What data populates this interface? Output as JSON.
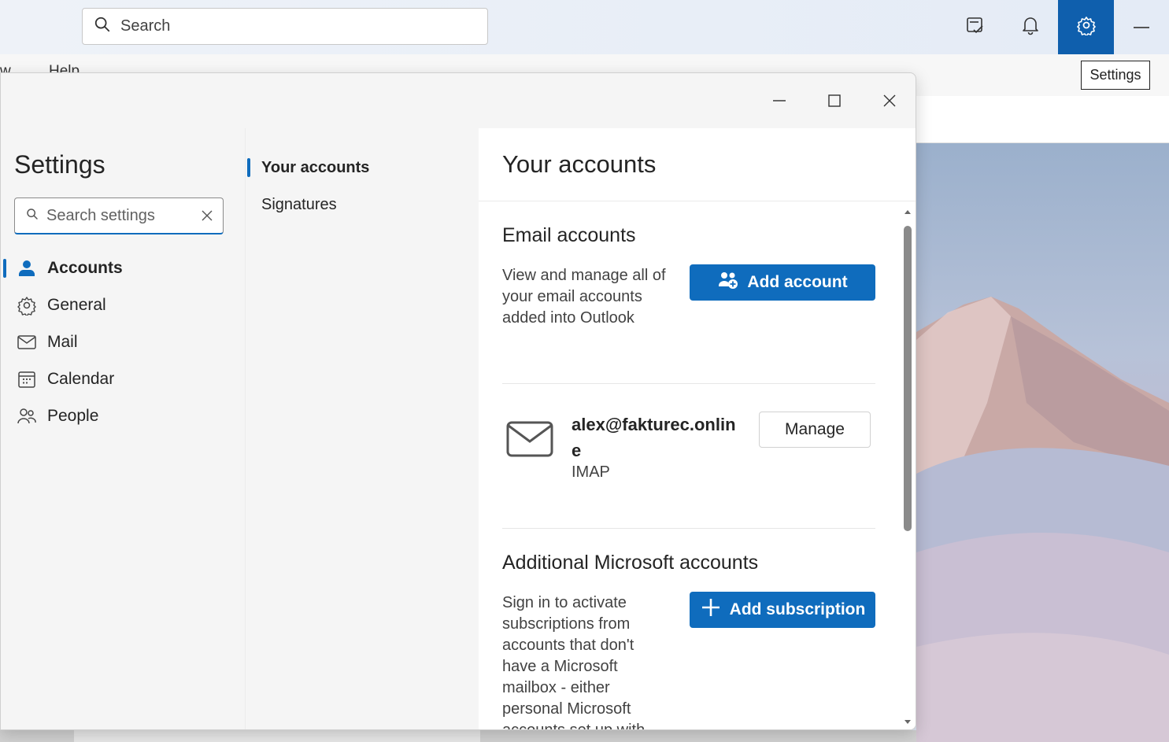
{
  "topbar": {
    "search_label": "Search",
    "icons": [
      "todo-icon",
      "bell-icon",
      "gear-icon",
      "minimize-icon"
    ],
    "accent": "#0f5fad"
  },
  "background_app": {
    "menu_fragment": "w",
    "menu_help": "Help",
    "tooltip": "Settings"
  },
  "settings": {
    "title": "Settings",
    "search_placeholder": "Search settings",
    "nav": [
      {
        "label": "Accounts",
        "icon": "person-icon",
        "selected": true
      },
      {
        "label": "General",
        "icon": "gear-icon",
        "selected": false
      },
      {
        "label": "Mail",
        "icon": "mail-icon",
        "selected": false
      },
      {
        "label": "Calendar",
        "icon": "calendar-icon",
        "selected": false
      },
      {
        "label": "People",
        "icon": "people-icon",
        "selected": false
      }
    ],
    "subnav": [
      {
        "label": "Your accounts",
        "selected": true
      },
      {
        "label": "Signatures",
        "selected": false
      }
    ]
  },
  "content": {
    "title": "Your accounts",
    "email_section": {
      "title": "Email accounts",
      "description": "View and manage all of your email accounts added into Outlook",
      "add_button": "Add account"
    },
    "account": {
      "email": "alex@fakturec.online",
      "type": "IMAP",
      "manage_button": "Manage"
    },
    "ms_section": {
      "title": "Additional Microsoft accounts",
      "description": "Sign in to activate subscriptions from accounts that don't have a Microsoft mailbox - either personal Microsoft accounts set up with",
      "add_button": "Add subscription"
    }
  },
  "colors": {
    "primary": "#0f6cbd",
    "dialog_bg": "#f5f5f5"
  }
}
